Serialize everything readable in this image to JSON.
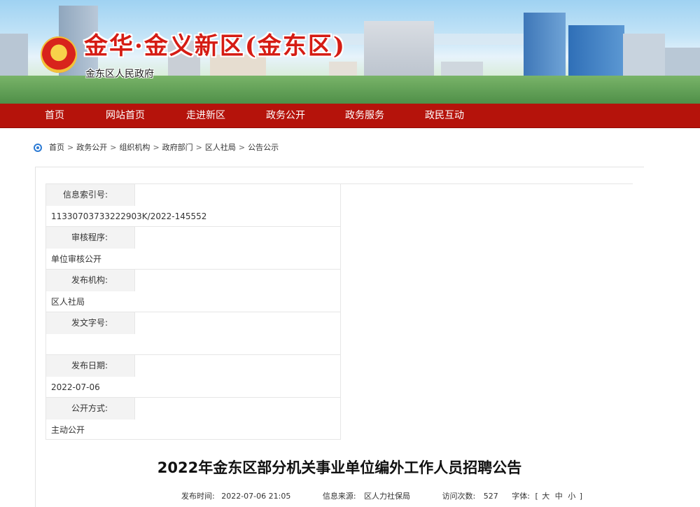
{
  "site": {
    "title": "金华·金义新区(金东区)",
    "subtitle": "金东区人民政府"
  },
  "nav": {
    "items": [
      {
        "label": "首页"
      },
      {
        "label": "网站首页"
      },
      {
        "label": "走进新区"
      },
      {
        "label": "政务公开"
      },
      {
        "label": "政务服务"
      },
      {
        "label": "政民互动"
      }
    ]
  },
  "breadcrumb": {
    "items": [
      "首页",
      "政务公开",
      "组织机构",
      "政府部门",
      "区人社局",
      "公告公示"
    ],
    "separator": ">"
  },
  "meta": {
    "rows": [
      {
        "label": "信息索引号:",
        "value": "11330703733222903K/2022-145552"
      },
      {
        "label": "审核程序:",
        "value": "单位审核公开"
      },
      {
        "label": "发布机构:",
        "value": "区人社局"
      },
      {
        "label": "发文字号:",
        "value": ""
      },
      {
        "label": "发布日期:",
        "value": "2022-07-06"
      },
      {
        "label": "公开方式:",
        "value": "主动公开"
      }
    ]
  },
  "article": {
    "title": "2022年金东区部分机关事业单位编外工作人员招聘公告",
    "publish_label": "发布时间:",
    "publish_time": "2022-07-06 21:05",
    "source_label": "信息来源:",
    "source": "区人力社保局",
    "visits_label": "访问次数:",
    "visits": "527",
    "font_label": "字体:",
    "font_open": "[",
    "font_large": "大",
    "font_medium": "中",
    "font_small": "小",
    "font_close": "]"
  },
  "colors": {
    "nav_bg": "#b5130b",
    "title_red": "#d51c14",
    "label_bg": "#f3f3f3",
    "border": "#e6e6e6"
  }
}
